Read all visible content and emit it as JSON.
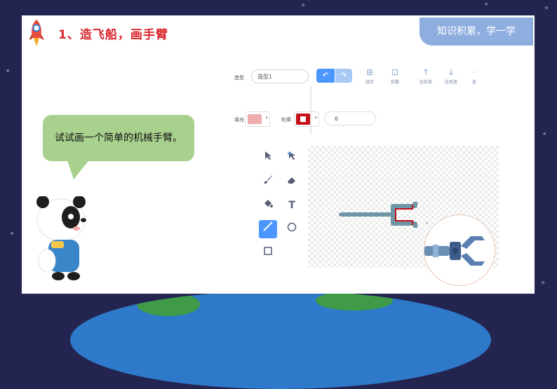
{
  "slide": {
    "section_title": "1、造飞船，画手臂",
    "tag": "知识积累，学一学",
    "bubble_text": "试试画一个简单的机械手臂。"
  },
  "editor": {
    "costume_label": "造型",
    "costume_name": "造型1",
    "toolbar": [
      {
        "label": "组合",
        "icon": "group-icon"
      },
      {
        "label": "拆散",
        "icon": "ungroup-icon"
      },
      {
        "label": "往前放",
        "icon": "forward-icon"
      },
      {
        "label": "往后放",
        "icon": "backward-icon"
      },
      {
        "label": "放",
        "icon": "front-icon"
      }
    ],
    "fill_label": "填充",
    "stroke_label": "轮廓",
    "stroke_width": "6",
    "colors": {
      "fill": "#efadad",
      "stroke": "#c5121a",
      "accent": "#4c97ff"
    }
  },
  "colors": {
    "background": "#23244f",
    "title": "#d9262c",
    "tag": "#8faee0",
    "bubble": "#a9d18e"
  }
}
